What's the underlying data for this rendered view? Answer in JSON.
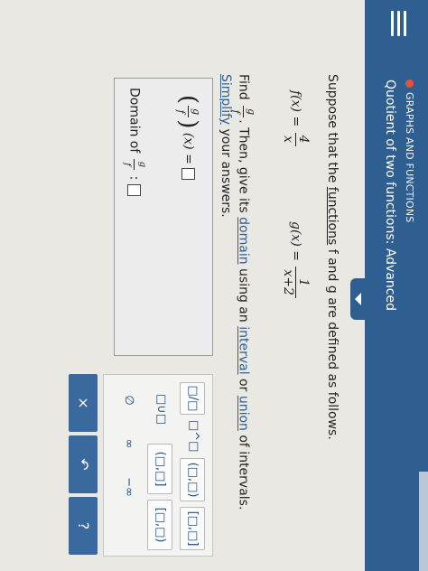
{
  "header": {
    "breadcrumb": "GRAPHS AND FUNCTIONS",
    "title": "Quotient of two functions: Advanced"
  },
  "question": {
    "intro_prefix": "Suppose that the ",
    "intro_link": "functions",
    "intro_middle": " f and g are defined as follows.",
    "f_lhs": "f(x) =",
    "f_num": "4",
    "f_den": "x",
    "g_lhs": "g(x) =",
    "g_num": "1",
    "g_den": "x+2",
    "find_prefix": "Find",
    "frac_num": "g",
    "frac_den": "f",
    "find_middle": ". Then, give its ",
    "find_link_domain": "domain",
    "find_using": " using an ",
    "find_link_interval": "interval",
    "find_or": " or ",
    "find_link_union": "union",
    "find_suffix": " of intervals.",
    "simplify_link": "Simplify",
    "simplify_suffix": " your answers."
  },
  "answer": {
    "expr_suffix": "(x) =",
    "domain_label": "Domain of",
    "domain_colon": ":"
  },
  "keypad": {
    "keys": [
      "□/□",
      "□^□",
      "(□,□)",
      "[□,□]",
      "□∪□",
      "(□,□]",
      "[□,□)",
      "∅",
      "∞",
      "−∞"
    ],
    "clear": "×",
    "undo": "↶",
    "help": "?"
  }
}
